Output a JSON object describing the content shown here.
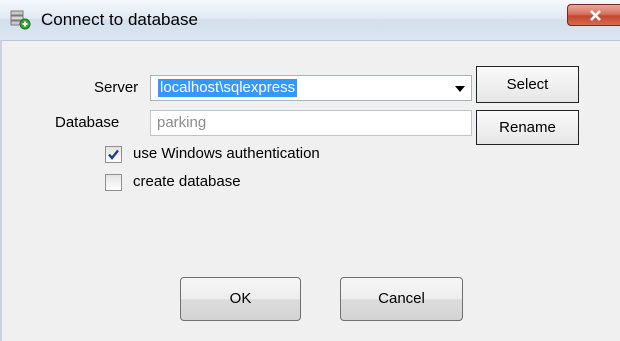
{
  "window": {
    "title": "Connect to database"
  },
  "icons": {
    "app": "database-connect-icon",
    "close": "close-icon",
    "dropdown": "chevron-down-icon",
    "check": "checkmark-icon"
  },
  "colors": {
    "selection": "#3399ff",
    "close_button": "#c94a33",
    "titlebar": "#dbe6f2"
  },
  "form": {
    "server_label": "Server",
    "server_value": "localhost\\sqlexpress",
    "database_label": "Database",
    "database_value": "parking",
    "select_label": "Select",
    "rename_label": "Rename",
    "windows_auth_label": "use Windows authentication",
    "windows_auth_checked": true,
    "create_db_label": "create database",
    "create_db_checked": false
  },
  "footer": {
    "ok_label": "OK",
    "cancel_label": "Cancel"
  }
}
